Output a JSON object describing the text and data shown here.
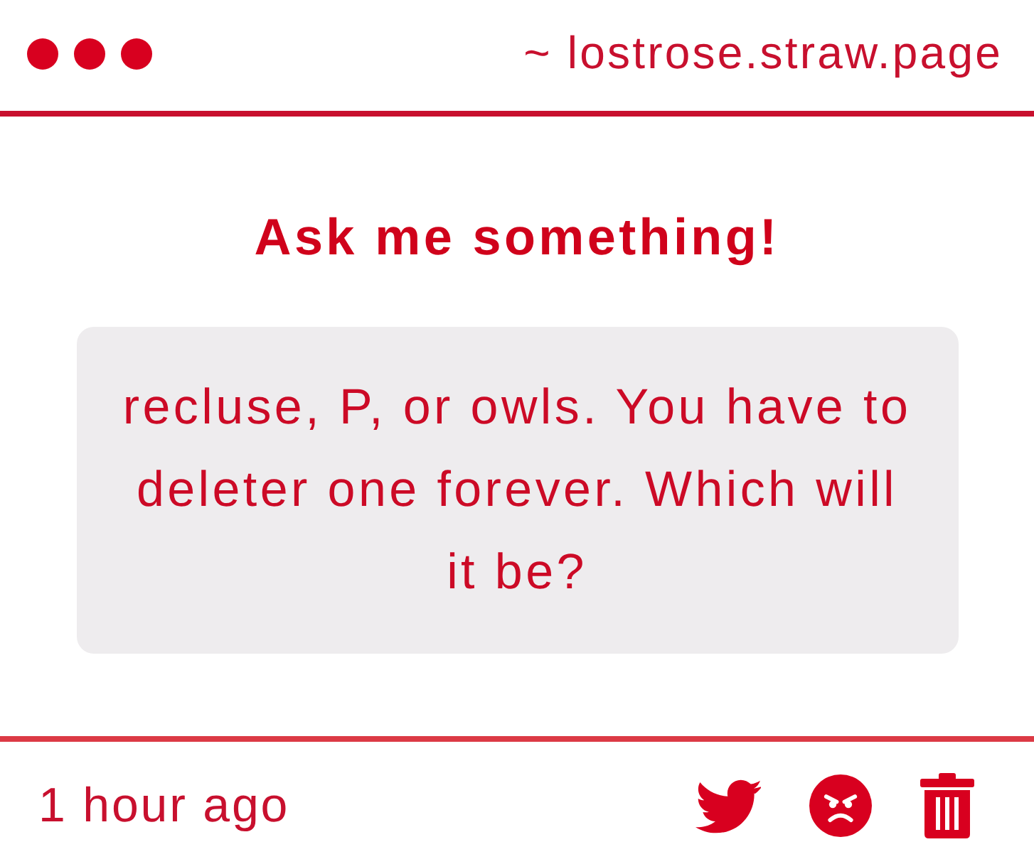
{
  "header": {
    "url": "~ lostrose.straw.page"
  },
  "heading": "Ask me something!",
  "question": "recluse, P, or owls. You have to deleter one forever. Which will it be?",
  "footer": {
    "time": "1 hour ago"
  }
}
